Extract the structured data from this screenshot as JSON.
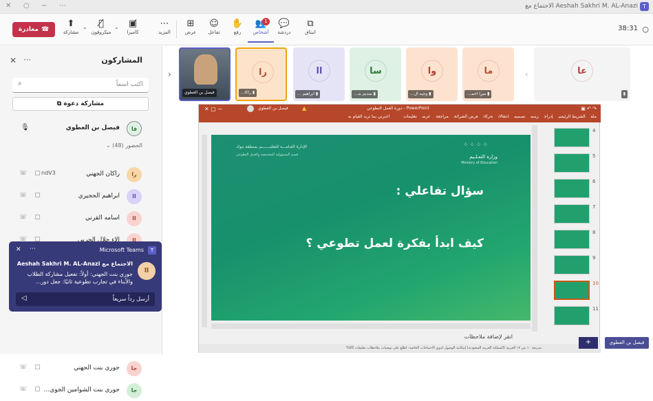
{
  "window": {
    "title": "Aeshah Sakhri M. AL-Anazi الاجتماع مع"
  },
  "toolbar": {
    "leave": "مغادرة",
    "items": [
      {
        "label": "مشاركة",
        "icon": "share-screen-icon"
      },
      {
        "label": "ميكروفون",
        "icon": "mic-off-icon"
      },
      {
        "label": "كاميرا",
        "icon": "camera-off-icon"
      },
      {
        "label": "المزيد",
        "icon": "more-icon"
      },
      {
        "label": "عرض",
        "icon": "view-icon"
      },
      {
        "label": "تفاعل",
        "icon": "react-icon"
      },
      {
        "label": "رفع",
        "icon": "raise-hand-icon"
      },
      {
        "label": "أشخاص",
        "icon": "people-icon",
        "badge": "1"
      },
      {
        "label": "دردشة",
        "icon": "chat-icon"
      },
      {
        "label": "انبثاق",
        "icon": "popout-icon"
      }
    ],
    "timer": "38:31"
  },
  "panel": {
    "title": "المشاركون",
    "search_placeholder": "اكتب اسماً",
    "share_invite": "مشاركة دعوة",
    "presenter": {
      "initials": "فا",
      "name": "فيصل بن العطوي"
    },
    "attendees_label": "الحضور (48)",
    "participants": [
      {
        "initials": "را",
        "name": "راكان الجهني",
        "color": "#f7d7a8",
        "fg": "#8a5a10",
        "extra": "ndV3"
      },
      {
        "initials": "اا",
        "name": "ابراهيم الحجيري",
        "color": "#d9d3f7",
        "fg": "#5b4fb0"
      },
      {
        "initials": "اا",
        "name": "اسامه القرني",
        "color": "#f8d3cf",
        "fg": "#b0423a"
      },
      {
        "initials": "اا",
        "name": "الاء جلال الحربي",
        "color": "#f8d3cf",
        "fg": "#b0423a"
      },
      {
        "initials": "جا",
        "name": "جوري بنت الجهني",
        "color": "#f8d3cf",
        "fg": "#b0423a"
      },
      {
        "initials": "جا",
        "name": "جوري بنت الشوامين الجوي...",
        "color": "#d4efd8",
        "fg": "#2e7a3a"
      }
    ]
  },
  "notification": {
    "app": "Microsoft Teams",
    "title": "الاجتماع مع Aeshah Sakhri M. AL-Anazi",
    "body": "جوري بنت الجهني: أولاً: تفعيل مشاركة الطلاب والأبناء في تجارب تطوعية ثانيًا: جعل دور...",
    "reply_placeholder": "أرسل رداً سريعاً",
    "avatar": "اا"
  },
  "strip": {
    "tiles": [
      {
        "name": "فيصل بن العطوي",
        "type": "video"
      },
      {
        "initials": "را",
        "name": "راكا...",
        "color": "#fde3c9",
        "fg": "#b0523a"
      },
      {
        "initials": "اا",
        "name": "ابراهيم ...",
        "color": "#e5e4f7",
        "fg": "#5b4fb0"
      },
      {
        "initials": "سا",
        "name": "سديم بنـ...",
        "color": "#dff1e4",
        "fg": "#2e7a3a"
      },
      {
        "initials": "وا",
        "name": "وجيه ال...",
        "color": "#fde3cf",
        "fg": "#b0423a"
      },
      {
        "initials": "ما",
        "name": "ميرا احمـ...",
        "color": "#fde3cf",
        "fg": "#b0523a"
      },
      {
        "initials": "عا",
        "name": "",
        "color": "#f4f4f4",
        "fg": "#b0423a"
      }
    ]
  },
  "ppt": {
    "title": "PowerPoint - دورة العمل التطوعي",
    "user": "فيصل بن العطوي",
    "tell_me": "أخبرني بما تريد القيام به",
    "menu": [
      "ملف",
      "الشريط الرئيسي",
      "إدراج",
      "رسم",
      "تصميم",
      "انتقالات",
      "حركات",
      "عرض الشرائح",
      "مراجعة",
      "عرض",
      "تعليمات"
    ],
    "slide": {
      "dept_line1": "الإدارة العـامـــة للتعليـــــــم بمنطقة تبوك",
      "dept_line2": "قسم المسؤولية المجتمعية والعمل التطوعي",
      "ministry_ar": "وزارة التعـلـيم",
      "ministry_en": "Ministry of Education",
      "question": "سؤال تفاعلي :",
      "body": "كيف ابدأ بفكرة لعمل تطوعي ؟"
    },
    "notes": "انقر لإضافة ملاحظات",
    "thumb_numbers": [
      "4",
      "5",
      "6",
      "7",
      "8",
      "9",
      "10",
      "11"
    ],
    "status": "شريحة ١٠ من ١٧   العربية (المملكة العربية السعودية)   إمكانية الوصول لذوي الاحتياجات الخاصة: اطلع على توصيات   ملاحظات   تعليقات   93%"
  },
  "bottom_name": "فيصل بن العطوي"
}
